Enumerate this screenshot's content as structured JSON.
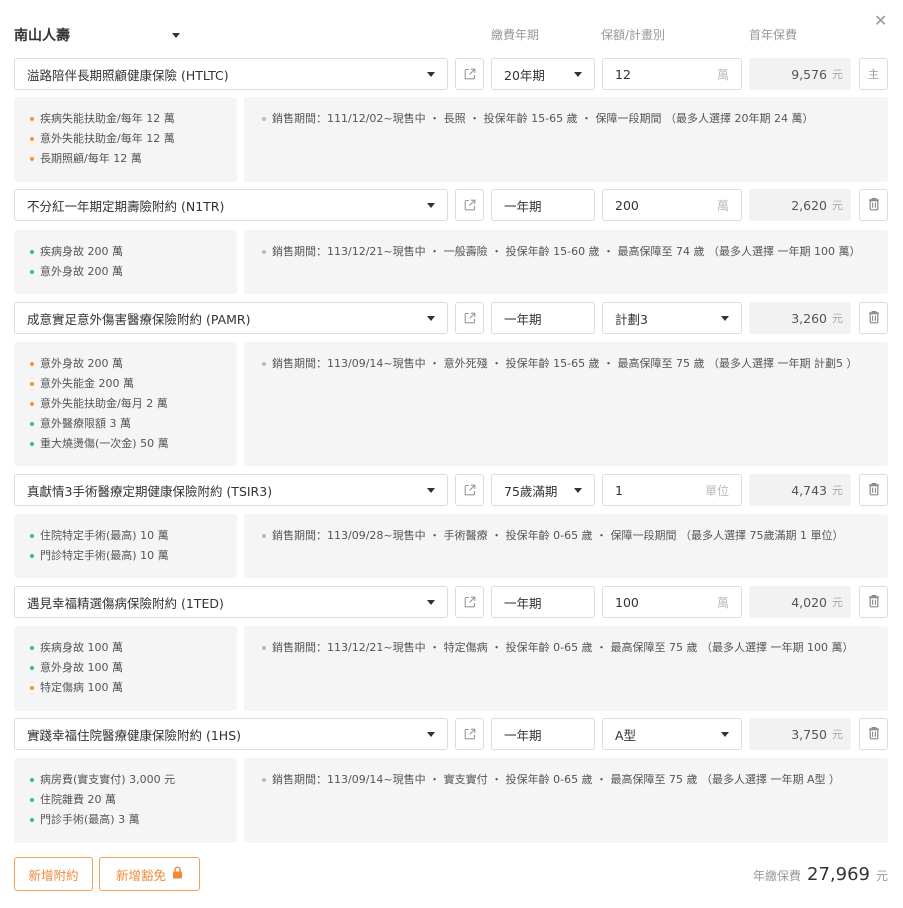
{
  "company": {
    "name": "南山人壽"
  },
  "headers": {
    "term": "繳費年期",
    "amount": "保額/計畫別",
    "premium": "首年保費"
  },
  "rows": [
    {
      "plan": "溢路陪伴長期照顧健康保險 (HTLTC)",
      "term": "20年期",
      "term_dropdown": true,
      "amount": "12",
      "unit": "萬",
      "premium": "9,576",
      "yuan": "元",
      "side": "主",
      "benefits": [
        {
          "text": "疾病失能扶助金/每年 12 萬",
          "color": "orange"
        },
        {
          "text": "意外失能扶助金/每年 12 萬",
          "color": "orange"
        },
        {
          "text": "長期照顧/每年 12 萬",
          "color": "orange"
        }
      ],
      "info": "銷售期間：111/12/02~現售中 ・ 長照 ・ 投保年齡 15-65 歲 ・ 保障一段期間 （最多人選擇 20年期 24 萬）"
    },
    {
      "plan": "不分紅一年期定期壽險附約 (N1TR)",
      "term": "一年期",
      "term_dropdown": false,
      "amount": "200",
      "unit": "萬",
      "premium": "2,620",
      "yuan": "元",
      "side": "trash",
      "benefits": [
        {
          "text": "疾病身故 200 萬",
          "color": "teal"
        },
        {
          "text": "意外身故 200 萬",
          "color": "teal"
        }
      ],
      "info": "銷售期間：113/12/21~現售中 ・ 一般壽險 ・ 投保年齡 15-60 歲 ・ 最高保障至 74 歲 （最多人選擇 一年期 100 萬）"
    },
    {
      "plan": "成意實足意外傷害醫療保險附約 (PAMR)",
      "term": "一年期",
      "term_dropdown": false,
      "amount": "計劃3",
      "amount_dropdown": true,
      "unit": "",
      "premium": "3,260",
      "yuan": "元",
      "side": "trash",
      "benefits": [
        {
          "text": "意外身故 200 萬",
          "color": "orange"
        },
        {
          "text": "意外失能金 200 萬",
          "color": "orange"
        },
        {
          "text": "意外失能扶助金/每月 2 萬",
          "color": "orange"
        },
        {
          "text": "意外醫療限額 3 萬",
          "color": "teal"
        },
        {
          "text": "重大燒燙傷(一次金) 50 萬",
          "color": "teal"
        }
      ],
      "info": "銷售期間：113/09/14~現售中 ・ 意外死殘 ・ 投保年齡 15-65 歲 ・ 最高保障至 75 歲 （最多人選擇 一年期 計劃5 ）"
    },
    {
      "plan": "真獻情3手術醫療定期健康保險附約 (TSIR3)",
      "term": "75歲滿期",
      "term_dropdown": true,
      "amount": "1",
      "unit": "單位",
      "premium": "4,743",
      "yuan": "元",
      "side": "trash",
      "benefits": [
        {
          "text": "住院特定手術(最高) 10 萬",
          "color": "teal"
        },
        {
          "text": "門診特定手術(最高) 10 萬",
          "color": "teal"
        }
      ],
      "info": "銷售期間：113/09/28~現售中 ・ 手術醫療 ・ 投保年齡 0-65 歲 ・ 保障一段期間 （最多人選擇 75歲滿期 1 單位）"
    },
    {
      "plan": "遇見幸福精選傷病保險附約 (1TED)",
      "term": "一年期",
      "term_dropdown": false,
      "amount": "100",
      "unit": "萬",
      "premium": "4,020",
      "yuan": "元",
      "side": "trash",
      "benefits": [
        {
          "text": "疾病身故 100 萬",
          "color": "teal"
        },
        {
          "text": "意外身故 100 萬",
          "color": "teal"
        },
        {
          "text": "特定傷病 100 萬",
          "color": "orange"
        }
      ],
      "info": "銷售期間：113/12/21~現售中 ・ 特定傷病 ・ 投保年齡 0-65 歲 ・ 最高保障至 75 歲 （最多人選擇 一年期 100 萬）"
    },
    {
      "plan": "實踐幸福住院醫療健康保險附約 (1HS)",
      "term": "一年期",
      "term_dropdown": false,
      "amount": "A型",
      "amount_dropdown": true,
      "unit": "",
      "premium": "3,750",
      "yuan": "元",
      "side": "trash",
      "benefits": [
        {
          "text": "病房費(實支實付) 3,000 元",
          "color": "teal"
        },
        {
          "text": "住院雜費 20 萬",
          "color": "teal"
        },
        {
          "text": "門診手術(最高) 3 萬",
          "color": "teal"
        }
      ],
      "info": "銷售期間：113/09/14~現售中 ・ 實支實付 ・ 投保年齡 0-65 歲 ・ 最高保障至 75 歲 （最多人選擇 一年期 A型 ）"
    }
  ],
  "footer": {
    "add_rider": "新增附約",
    "add_waiver": "新增豁免",
    "total_label": "年繳保費",
    "total_value": "27,969",
    "total_unit": "元"
  },
  "colors": {
    "teal": "#34b6b8",
    "orange": "#f0953a",
    "accent": "#f08a3a"
  },
  "icons": {
    "close": "close-icon",
    "caret": "chevron-down-icon",
    "external": "external-link-icon",
    "trash": "trash-icon",
    "lock": "lock-icon"
  }
}
